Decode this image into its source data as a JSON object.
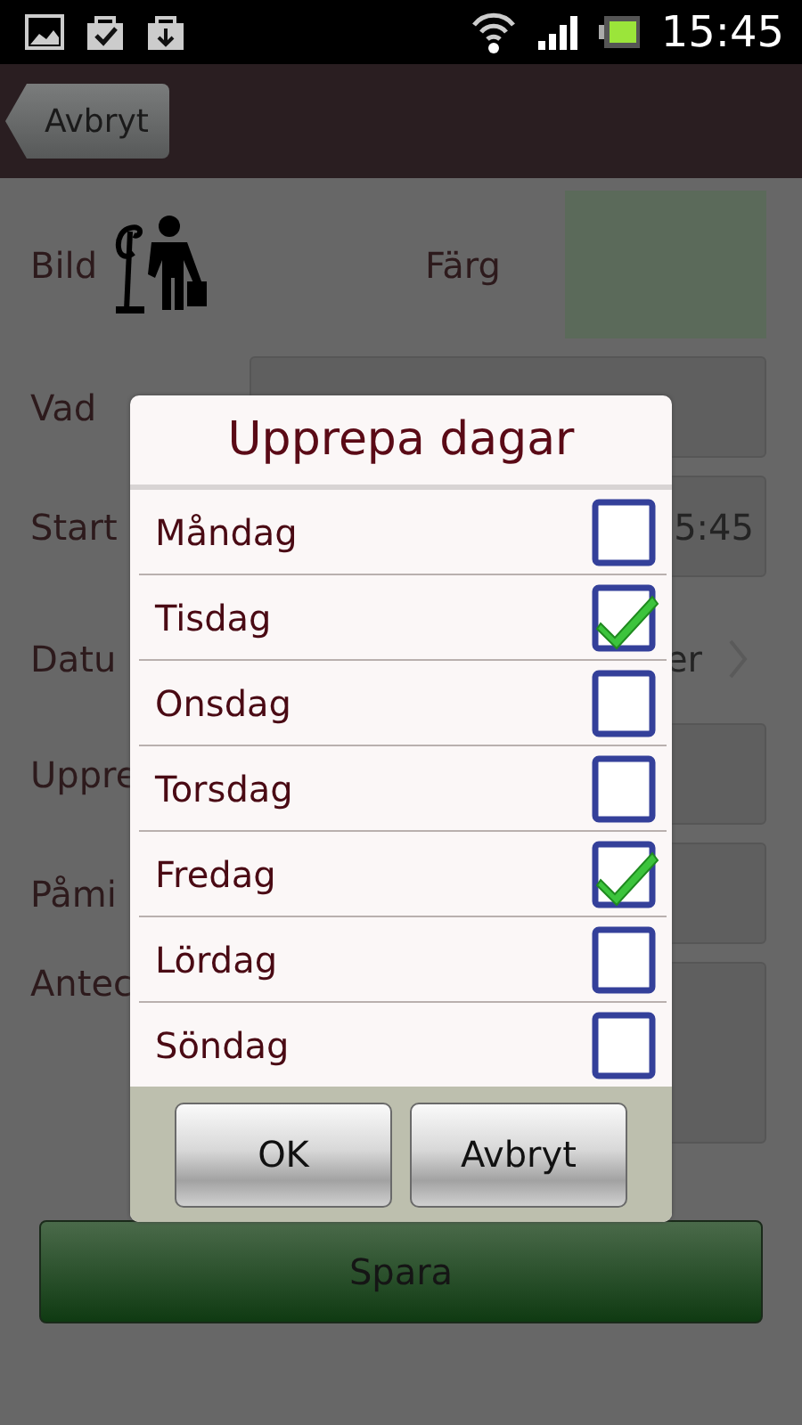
{
  "status_bar": {
    "time": "15:45"
  },
  "action_bar": {
    "back_button": "Avbryt"
  },
  "form": {
    "image_label": "Bild",
    "color_label": "Färg",
    "rows": [
      {
        "label": "Vad",
        "kind": "field"
      },
      {
        "label": "Start",
        "kind": "field",
        "value": "5:45"
      },
      {
        "label": "Datu",
        "kind": "select",
        "value": "er"
      },
      {
        "label": "Uppre",
        "kind": "field"
      },
      {
        "label": "Påmi",
        "kind": "field"
      },
      {
        "label": "Antec",
        "kind": "notes"
      }
    ],
    "save_button": "Spara"
  },
  "dialog": {
    "title": "Upprepa dagar",
    "days": [
      {
        "label": "Måndag",
        "checked": false
      },
      {
        "label": "Tisdag",
        "checked": true
      },
      {
        "label": "Onsdag",
        "checked": false
      },
      {
        "label": "Torsdag",
        "checked": false
      },
      {
        "label": "Fredag",
        "checked": true
      },
      {
        "label": "Lördag",
        "checked": false
      },
      {
        "label": "Söndag",
        "checked": false
      }
    ],
    "buttons": [
      "OK",
      "Avbryt"
    ]
  }
}
